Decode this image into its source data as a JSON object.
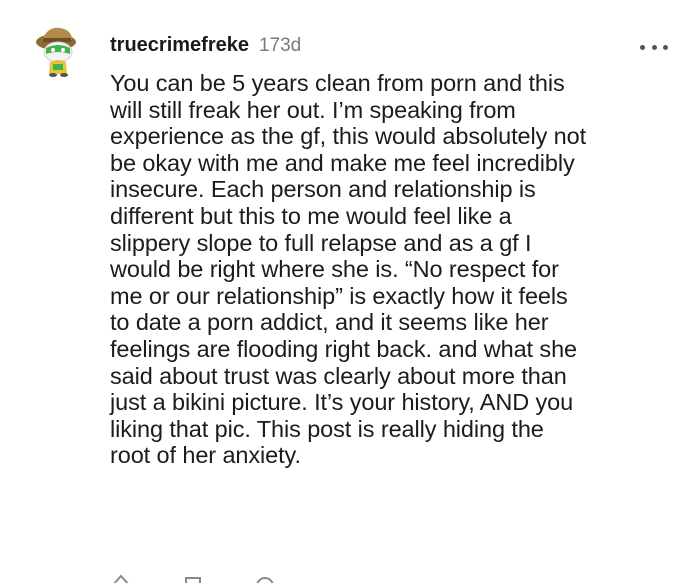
{
  "comment": {
    "username": "truecrimefreke",
    "age": "173d",
    "more_icon": "more-horizontal-icon",
    "avatar_icon": "snoo-avatar-icon",
    "body": "You can be 5 years clean from porn and this\nwill still freak her out. I’m speaking from\nexperience as the gf, this would absolutely not\nbe okay with me and make me feel incredibly\ninsecure. Each person and relationship is\ndifferent but this to me would feel like a\nslippery slope to full relapse and as a gf I\nwould be right where she is. “No respect for\nme or our relationship” is exactly how it feels\nto date a porn addict, and it seems like her\nfeelings are flooding right back. and what she\nsaid about trust was clearly about more than\njust a bikini picture. It’s your history, AND you\nliking that pic. This post is really hiding the\nroot of her anxiety.",
    "actions": [
      "upvote-icon",
      "reply-icon",
      "award-icon"
    ]
  }
}
